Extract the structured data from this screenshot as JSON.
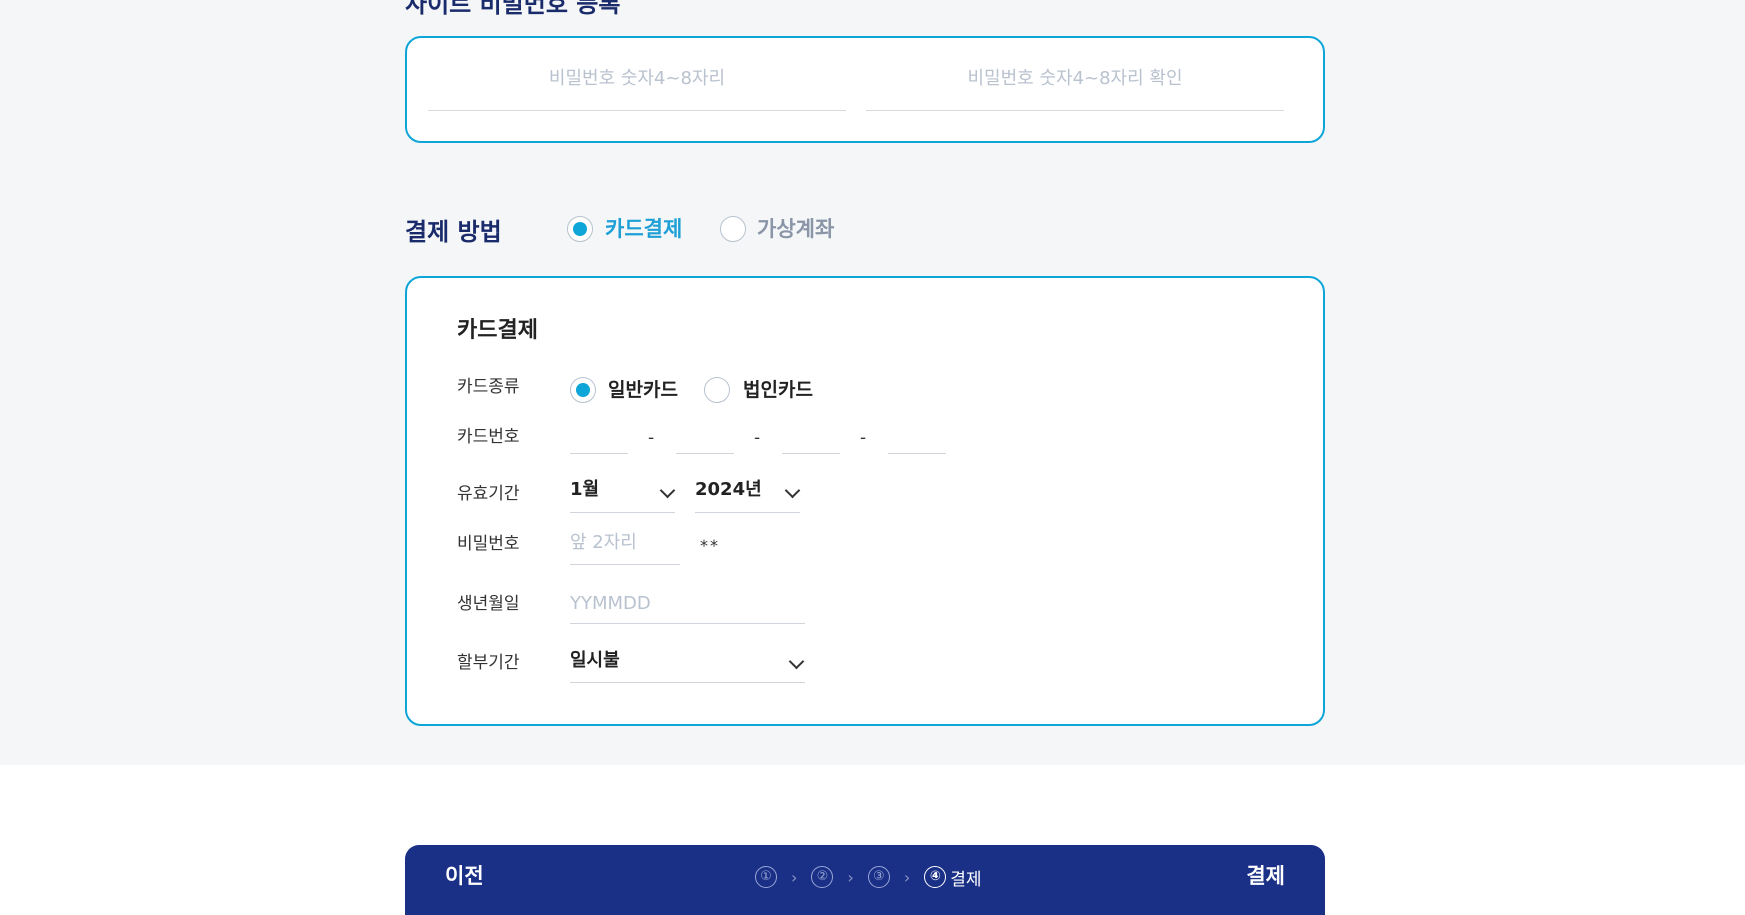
{
  "header": {
    "partial_heading": "사이트 비밀번호 등록"
  },
  "password_section": {
    "password_placeholder": "비밀번호 숫자4~8자리",
    "confirm_placeholder": "비밀번호 숫자4~8자리 확인"
  },
  "payment_method": {
    "title": "결제 방법",
    "options": [
      {
        "label": "카드결제",
        "checked": true
      },
      {
        "label": "가상계좌",
        "checked": false
      }
    ]
  },
  "card_payment": {
    "title": "카드결제",
    "card_type": {
      "label": "카드종류",
      "options": [
        {
          "label": "일반카드",
          "checked": true
        },
        {
          "label": "법인카드",
          "checked": false
        }
      ]
    },
    "card_number": {
      "label": "카드번호",
      "separator": "-"
    },
    "expiry": {
      "label": "유효기간",
      "month": "1월",
      "year": "2024년"
    },
    "password": {
      "label": "비밀번호",
      "placeholder": "앞 2자리",
      "mask": "**"
    },
    "birth": {
      "label": "생년월일",
      "placeholder": "YYMMDD"
    },
    "installment": {
      "label": "할부기간",
      "value": "일시불"
    }
  },
  "footer_bar": {
    "prev_label": "이전",
    "next_label": "결제",
    "steps": [
      "①",
      "②",
      "③",
      "④"
    ],
    "arrow": "›",
    "current_step_label": "결제"
  },
  "colors": {
    "accent": "#0ea5d9",
    "navy": "#1a2f86",
    "title_navy": "#1a2b6b",
    "placeholder": "#b9c2cf"
  }
}
